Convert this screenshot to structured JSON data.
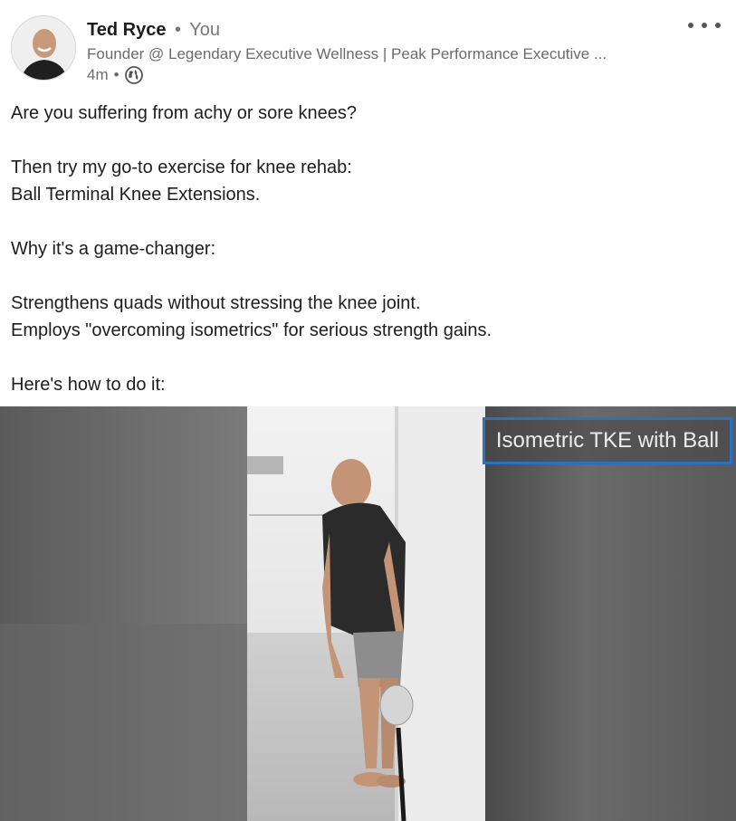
{
  "post": {
    "author_name": "Ted Ryce",
    "separator": "•",
    "you_label": "You",
    "headline": "Founder @ Legendary Executive Wellness | Peak Performance Executive ...",
    "time": "4m",
    "time_separator": "•",
    "visibility_icon": "globe-icon",
    "more_icon": "more-options-icon",
    "text_lines": [
      "Are you suffering from achy or sore knees?",
      "",
      "Then try my go-to exercise for knee rehab:",
      "Ball Terminal Knee Extensions.",
      "",
      "Why it's a game-changer:",
      "",
      "Strengthens quads without stressing the knee joint.",
      "Employs \"overcoming isometrics\" for serious strength gains.",
      "",
      "Here's how to do it:"
    ]
  },
  "media": {
    "overlay_label": "Isometric TKE with Ball",
    "overlay_border_color": "#2d6fc0"
  }
}
